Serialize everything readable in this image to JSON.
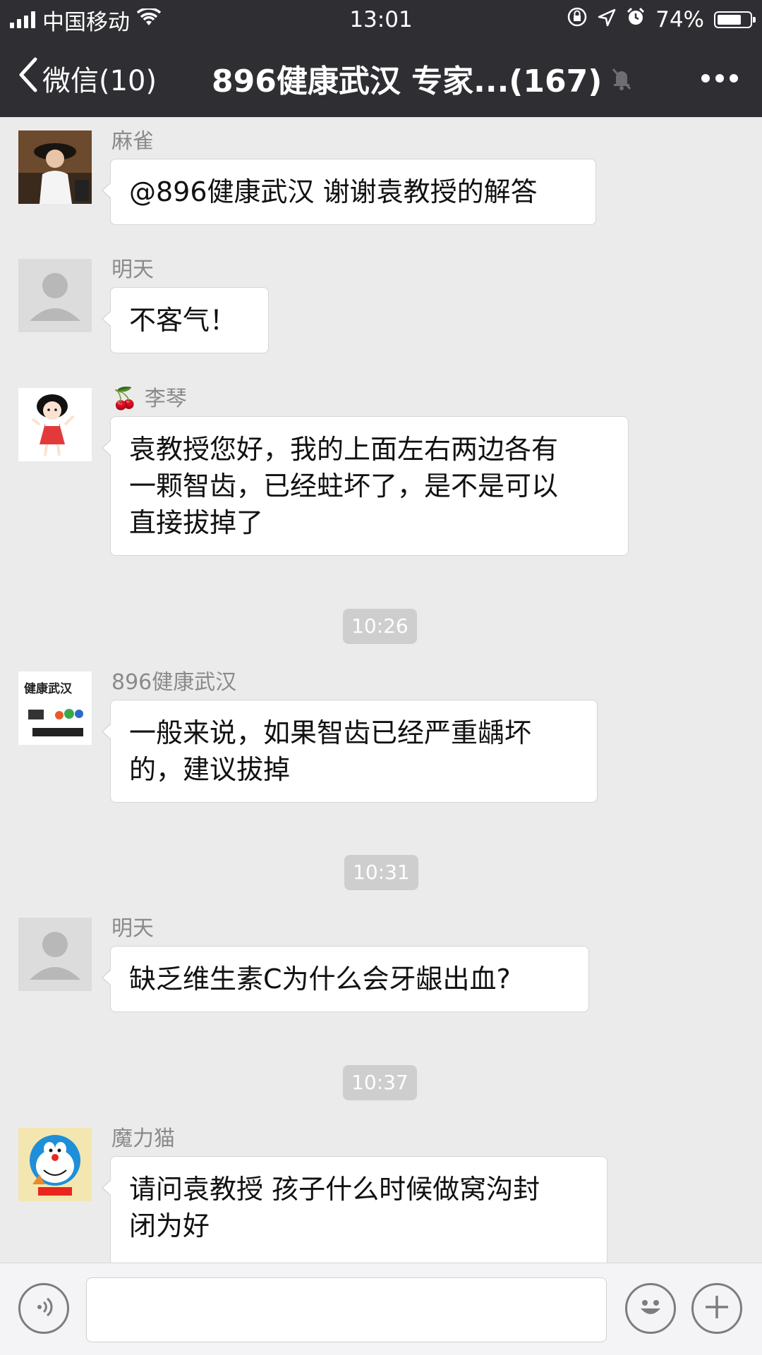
{
  "status_bar": {
    "carrier": "中国移动",
    "time": "13:01",
    "battery_percent_label": "74%",
    "battery_level": 0.74,
    "icons": [
      "signal-bars-icon",
      "wifi-icon",
      "rotation-lock-icon",
      "location-arrow-icon",
      "alarm-icon",
      "battery-icon"
    ]
  },
  "nav": {
    "back_label": "微信(10)",
    "title": "896健康武汉 专家...(167)",
    "icons": [
      "back-chevron-icon",
      "mute-bell-icon",
      "more-dots-icon"
    ]
  },
  "messages": [
    {
      "sender": "麻雀",
      "lines": [
        "@896健康武汉 谢谢袁教授的解答"
      ]
    },
    {
      "sender": "明天",
      "lines": [
        "不客气！"
      ]
    },
    {
      "sender_emoji": "🍒",
      "sender": "李琴",
      "lines": [
        "袁教授您好，我的上面左右两边各有",
        "一颗智齿，已经蛀坏了，是不是可以",
        "直接拔掉了"
      ]
    },
    {
      "timestamp": "10:26"
    },
    {
      "sender": "896健康武汉",
      "lines": [
        "一般来说，如果智齿已经严重龋坏",
        "的，建议拔掉"
      ]
    },
    {
      "timestamp": "10:31"
    },
    {
      "sender": "明天",
      "lines": [
        "缺乏维生素C为什么会牙龈出血?"
      ]
    },
    {
      "timestamp": "10:37"
    },
    {
      "sender": "魔力猫",
      "lines": [
        "请问袁教授 孩子什么时候做窝沟封",
        "闭为好"
      ]
    }
  ],
  "avatar_logo_text": "健康武汉",
  "input_bar": {
    "icons": [
      "voice-icon",
      "emoji-icon",
      "plus-icon"
    ],
    "placeholder": ""
  },
  "colors": {
    "header_bg": "#2e2e33",
    "chat_bg": "#ebebeb",
    "bubble_bg": "#ffffff",
    "timestamp_bg": "#cecece"
  }
}
